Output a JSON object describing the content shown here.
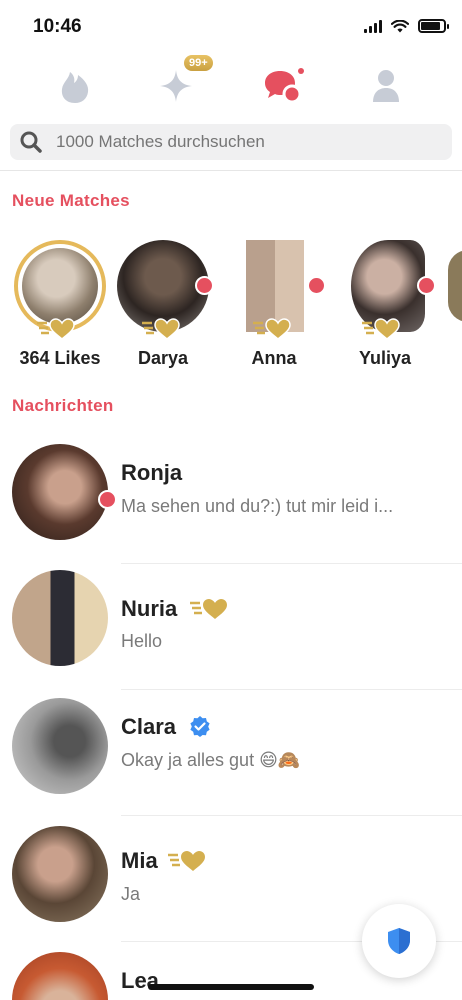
{
  "status_bar": {
    "time": "10:46"
  },
  "nav": {
    "items": [
      "flame-tab",
      "top-picks-tab",
      "messages-tab",
      "profile-tab"
    ],
    "top_picks_badge": "99+",
    "active": "messages-tab",
    "colors": {
      "active": "#e5505f",
      "inactive": "#c7ccd6",
      "gold": "#d4af4f"
    }
  },
  "search": {
    "placeholder": "1000 Matches durchsuchen"
  },
  "new_matches": {
    "title": "Neue Matches",
    "items": [
      {
        "name": "364 Likes",
        "gold_ring": true,
        "unread": false
      },
      {
        "name": "Darya",
        "unread": true
      },
      {
        "name": "Anna",
        "unread": true
      },
      {
        "name": "Yuliya",
        "unread": true
      }
    ]
  },
  "messages": {
    "title": "Nachrichten",
    "items": [
      {
        "name": "Ronja",
        "text": "Ma sehen und du?:) tut mir leid i...",
        "unread": true
      },
      {
        "name": "Nuria",
        "text": "Hello",
        "badge": "super-like-heart"
      },
      {
        "name": "Clara",
        "text": "Okay ja alles gut 😄🙈",
        "badge": "verified-check"
      },
      {
        "name": "Mia",
        "text": "Ja",
        "badge": "super-like-heart"
      },
      {
        "name": "Lea",
        "text": ""
      }
    ]
  }
}
